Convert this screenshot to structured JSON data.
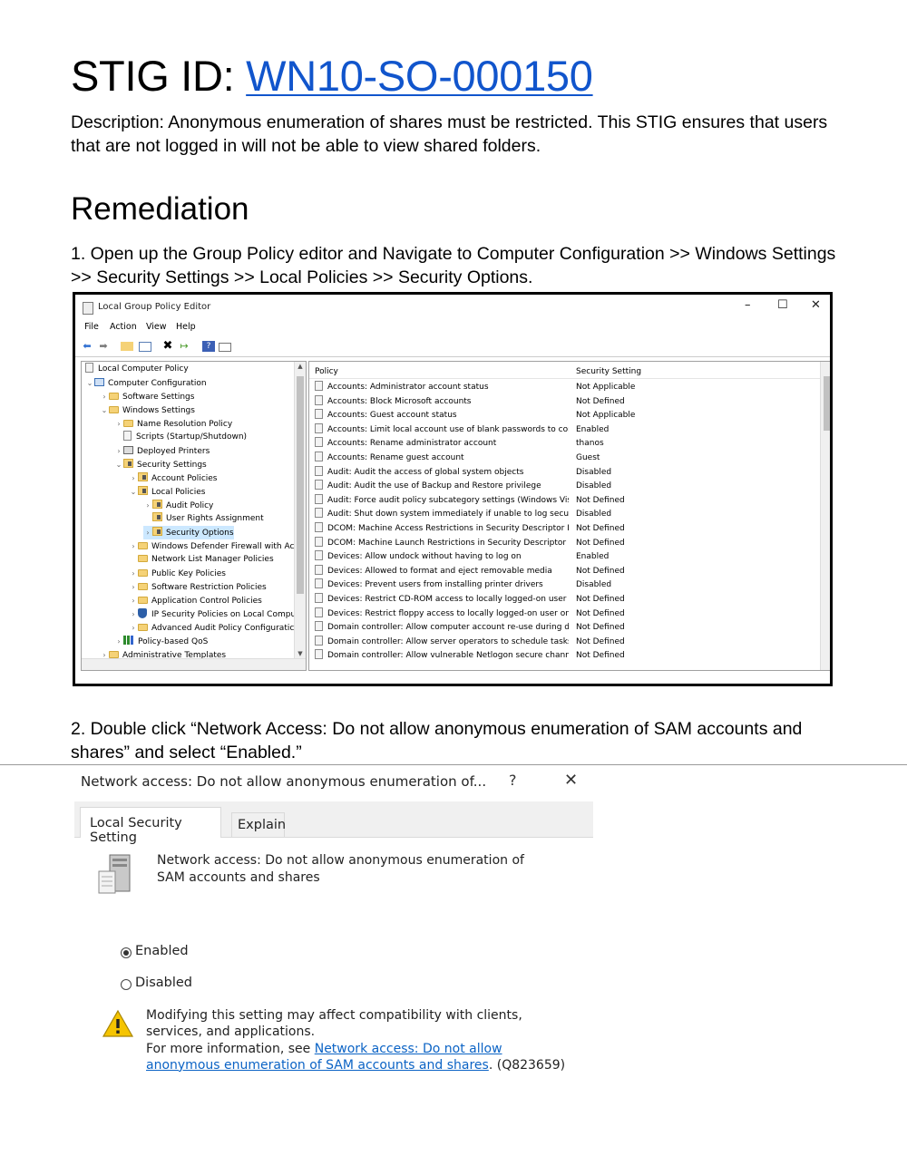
{
  "heading": {
    "prefix": "STIG ID: ",
    "id": "WN10-SO-000150"
  },
  "description": "Description: Anonymous enumeration of shares must be restricted. This STIG ensures that users that are not logged in will not be able to view shared folders.",
  "remediation_heading": "Remediation",
  "step1": "1. Open up the Group Policy editor and Navigate to Computer Configuration >> Windows Settings >> Security Settings >> Local Policies >> Security Options.",
  "step2": "2. Double click “Network Access: Do not allow anonymous enumeration of SAM accounts and shares” and select “Enabled.”",
  "gpedit": {
    "title": "Local Group Policy Editor",
    "window_buttons": {
      "minimize": "–",
      "maximize": "☐",
      "close": "✕"
    },
    "menu": [
      "File",
      "Action",
      "View",
      "Help"
    ],
    "toolbar_icons": [
      "back-arrow-icon",
      "forward-arrow-icon",
      "up-folder-icon",
      "show-hide-tree-icon",
      "delete-icon",
      "export-list-icon",
      "help-icon",
      "properties-icon"
    ],
    "tree": [
      "Local Computer Policy",
      "Computer Configuration",
      "Software Settings",
      "Windows Settings",
      "Name Resolution Policy",
      "Scripts (Startup/Shutdown)",
      "Deployed Printers",
      "Security Settings",
      "Account Policies",
      "Local Policies",
      "Audit Policy",
      "User Rights Assignment",
      "Security Options",
      "Windows Defender Firewall with Ac",
      "Network List Manager Policies",
      "Public Key Policies",
      "Software Restriction Policies",
      "Application Control Policies",
      "IP Security Policies on Local Compu",
      "Advanced Audit Policy Configuratic",
      "Policy-based QoS",
      "Administrative Templates"
    ],
    "columns": [
      "Policy",
      "Security Setting"
    ],
    "rows": [
      [
        "Accounts: Administrator account status",
        "Not Applicable"
      ],
      [
        "Accounts: Block Microsoft accounts",
        "Not Defined"
      ],
      [
        "Accounts: Guest account status",
        "Not Applicable"
      ],
      [
        "Accounts: Limit local account use of blank passwords to cons...",
        "Enabled"
      ],
      [
        "Accounts: Rename administrator account",
        "thanos"
      ],
      [
        "Accounts: Rename guest account",
        "Guest"
      ],
      [
        "Audit: Audit the access of global system objects",
        "Disabled"
      ],
      [
        "Audit: Audit the use of Backup and Restore privilege",
        "Disabled"
      ],
      [
        "Audit: Force audit policy subcategory settings (Windows Vista...",
        "Not Defined"
      ],
      [
        "Audit: Shut down system immediately if unable to log securit...",
        "Disabled"
      ],
      [
        "DCOM: Machine Access Restrictions in Security Descriptor Def...",
        "Not Defined"
      ],
      [
        "DCOM: Machine Launch Restrictions in Security Descriptor De...",
        "Not Defined"
      ],
      [
        "Devices: Allow undock without having to log on",
        "Enabled"
      ],
      [
        "Devices: Allowed to format and eject removable media",
        "Not Defined"
      ],
      [
        "Devices: Prevent users from installing printer drivers",
        "Disabled"
      ],
      [
        "Devices: Restrict CD-ROM access to locally logged-on user on...",
        "Not Defined"
      ],
      [
        "Devices: Restrict floppy access to locally logged-on user only",
        "Not Defined"
      ],
      [
        "Domain controller: Allow computer account re-use during do...",
        "Not Defined"
      ],
      [
        "Domain controller: Allow server operators to schedule tasks",
        "Not Defined"
      ],
      [
        "Domain controller: Allow vulnerable Netlogon secure channel...",
        "Not Defined"
      ]
    ]
  },
  "dialog": {
    "title": "Network access: Do not allow anonymous enumeration of...",
    "help_button": "?",
    "close_button": "✕",
    "tabs": [
      "Local Security Setting",
      "Explain"
    ],
    "policy_name": "Network access: Do not allow anonymous enumeration of SAM accounts and shares",
    "options": [
      "Enabled",
      "Disabled"
    ],
    "selected": "Enabled",
    "warning": "Modifying this setting may affect compatibility with clients, services, and applications.",
    "more_info_prefix": "For more information, see ",
    "more_info_link": "Network access: Do not allow anonymous enumeration of SAM accounts and shares",
    "more_info_suffix": ". (Q823659)"
  }
}
